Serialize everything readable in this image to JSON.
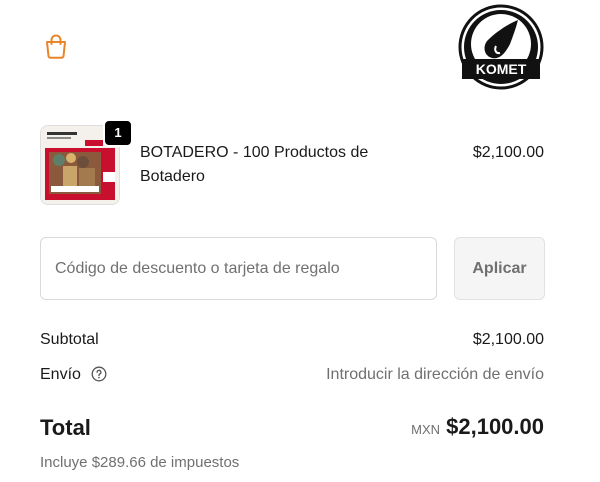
{
  "header": {
    "cart_icon": "shopping-bag-icon",
    "logo_text": "KOMET",
    "accent_color": "#e8862b"
  },
  "cart": {
    "items": [
      {
        "quantity": "1",
        "title": "BOTADERO - 100 Productos de Botadero",
        "price": "$2,100.00",
        "thumbnail": "product-box-image"
      }
    ]
  },
  "discount": {
    "placeholder": "Código de descuento o tarjeta de regalo",
    "value": "",
    "apply_label": "Aplicar"
  },
  "summary": {
    "subtotal_label": "Subtotal",
    "subtotal_value": "$2,100.00",
    "shipping_label": "Envío",
    "shipping_help_icon": "question-circle-icon",
    "shipping_value": "Introducir la dirección de envío",
    "total_label": "Total",
    "currency": "MXN",
    "total_value": "$2,100.00",
    "tax_note": "Incluye $289.66 de impuestos"
  }
}
